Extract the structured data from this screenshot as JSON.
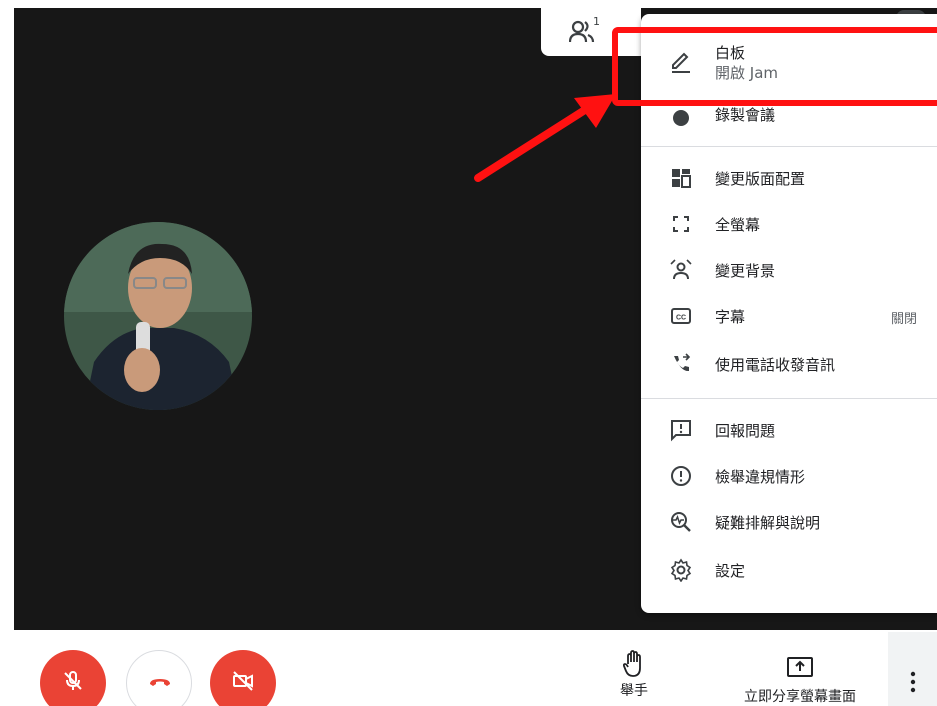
{
  "participants": {
    "count": "1"
  },
  "menu": {
    "whiteboard": {
      "label": "白板",
      "sub": "開啟 Jam"
    },
    "record": {
      "label": "錄製會議"
    },
    "items": [
      {
        "label": "變更版面配置",
        "icon": "layout-icon"
      },
      {
        "label": "全螢幕",
        "icon": "fullscreen-icon"
      },
      {
        "label": "變更背景",
        "icon": "background-icon"
      },
      {
        "label": "字幕",
        "icon": "captions-icon",
        "value": "關閉"
      },
      {
        "label": "使用電話收發音訊",
        "icon": "phone-audio-icon"
      },
      {
        "label": "回報問題",
        "icon": "feedback-icon"
      },
      {
        "label": "檢舉違規情形",
        "icon": "report-abuse-icon"
      },
      {
        "label": "疑難排解與說明",
        "icon": "troubleshoot-icon"
      },
      {
        "label": "設定",
        "icon": "settings-icon"
      }
    ]
  },
  "bottom": {
    "raise_hand": "舉手",
    "present_now": "立即分享螢幕畫面"
  },
  "colors": {
    "stage": "#171717",
    "danger": "#ea4335",
    "annotation": "#ff1111"
  }
}
